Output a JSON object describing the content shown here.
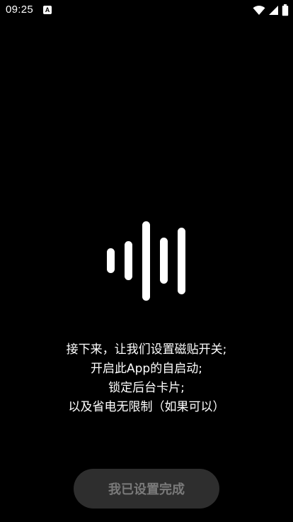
{
  "status_bar": {
    "time": "09:25",
    "notification_badge": "A",
    "icons": [
      "wifi-icon",
      "cellular-signal-icon",
      "battery-icon"
    ]
  },
  "waveform_icon": "sound-waveform-icon",
  "message_lines": [
    "接下来，让我们设置磁贴开关;",
    "开启此App的自启动;",
    "锁定后台卡片;",
    "以及省电无限制（如果可以）"
  ],
  "done_button": {
    "label": "我已设置完成"
  },
  "colors": {
    "background": "#000000",
    "text": "#ffffff",
    "button_background": "#2e2e2e",
    "button_text": "#7a7a7a"
  }
}
